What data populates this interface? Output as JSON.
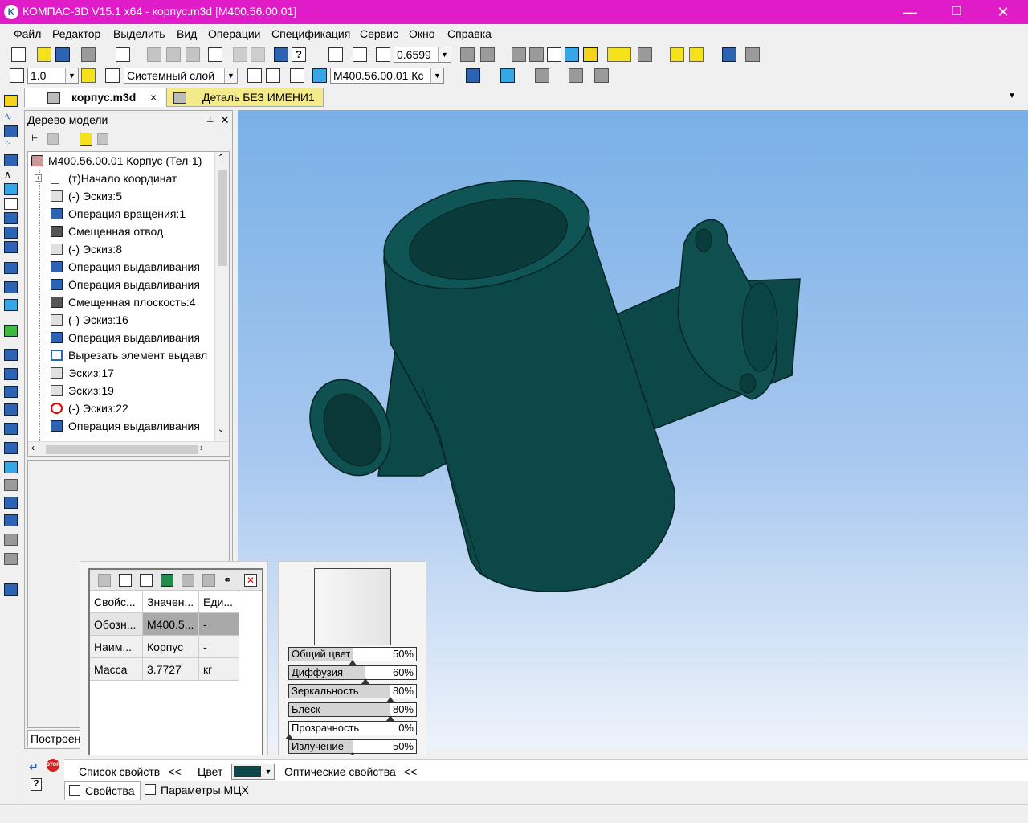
{
  "window": {
    "title": "КОМПАС-3D V15.1 x64 - корпус.m3d [М400.56.00.01]",
    "logo_letter": "K",
    "minimize": "—",
    "maximize": "❐",
    "close": "✕"
  },
  "menu": [
    "Файл",
    "Редактор",
    "Выделить",
    "Вид",
    "Операции",
    "Спецификация",
    "Сервис",
    "Окно",
    "Справка"
  ],
  "toolbar1": {
    "zoom_value": "0.6599"
  },
  "toolbar2": {
    "step_value": "1.0",
    "layer_value": "Системный слой",
    "designation_value": "М400.56.00.01 Кс"
  },
  "tabs": [
    {
      "label": "корпус.m3d",
      "close": "×"
    },
    {
      "label": "Деталь БЕЗ ИМЕНИ1"
    }
  ],
  "tabs_menu_arrow": "▼",
  "tree": {
    "title": "Дерево модели",
    "pin": "📌",
    "close": "✕",
    "root": "М400.56.00.01 Корпус (Тел-1)",
    "items": [
      {
        "label": "(т)Начало координат",
        "icon": "axis-icon"
      },
      {
        "label": "(-) Эскиз:5",
        "icon": "sketch-icon"
      },
      {
        "label": "Операция вращения:1",
        "icon": "revolve-icon"
      },
      {
        "label": "Смещенная отвод",
        "icon": "plane-icon"
      },
      {
        "label": "(-) Эскиз:8",
        "icon": "sketch-icon"
      },
      {
        "label": "Операция выдавливания",
        "icon": "extrude-icon"
      },
      {
        "label": "Операция выдавливания",
        "icon": "extrude-icon"
      },
      {
        "label": "Смещенная плоскость:4",
        "icon": "plane-icon"
      },
      {
        "label": "(-) Эскиз:16",
        "icon": "sketch-icon"
      },
      {
        "label": "Операция выдавливания",
        "icon": "extrude-icon"
      },
      {
        "label": "Вырезать элемент выдавл",
        "icon": "cut-icon"
      },
      {
        "label": "Эскиз:17",
        "icon": "sketch-icon"
      },
      {
        "label": "Эскиз:19",
        "icon": "sketch-icon"
      },
      {
        "label": "(-) Эскиз:22",
        "icon": "sketch-error-icon"
      },
      {
        "label": "Операция выдавливания",
        "icon": "extrude-icon"
      }
    ],
    "bottom_tab": "Построен"
  },
  "properties": {
    "headers": [
      "Свойс...",
      "Значен...",
      "Еди..."
    ],
    "rows": [
      [
        "Обозн...",
        "М400.5...",
        "-"
      ],
      [
        "Наим...",
        "Корпус",
        "-"
      ],
      [
        "Масса",
        "3.7727",
        "кг"
      ]
    ],
    "tab_label": "Список свойств",
    "collapse": "<<",
    "color_label": "Цвет",
    "color_value": "#0d4848"
  },
  "optics": {
    "sliders": [
      {
        "label": "Общий цвет",
        "value": "50%",
        "level": 0.5
      },
      {
        "label": "Диффузия",
        "value": "60%",
        "level": 0.6
      },
      {
        "label": "Зеркальность",
        "value": "80%",
        "level": 0.8
      },
      {
        "label": "Блеск",
        "value": "80%",
        "level": 0.8
      },
      {
        "label": "Прозрачность",
        "value": "0%",
        "level": 0.0
      },
      {
        "label": "Излучение",
        "value": "50%",
        "level": 0.5
      }
    ],
    "tab_label": "Оптические свойства",
    "collapse": "<<"
  },
  "bottom_tabs": [
    "Свойства",
    "Параметры МЦХ"
  ],
  "colors": {
    "model": "#0d4848",
    "model_edge": "#052424",
    "model_light": "#145e5e",
    "titlebar": "#e01cc8"
  }
}
